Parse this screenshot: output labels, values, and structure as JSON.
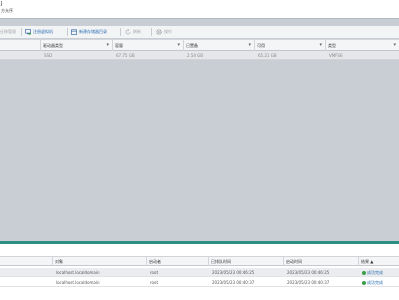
{
  "header": {
    "title": "J",
    "subtitle": "方允序"
  },
  "toolbar": {
    "items": [
      {
        "label": "迁移管理",
        "icon": "partial-icon",
        "state": "disabled"
      },
      {
        "label": "注册虚拟机",
        "icon": "register-vm-icon",
        "state": "enabled"
      },
      {
        "label": "新建存储器目录",
        "icon": "new-folder-icon",
        "state": "enabled"
      },
      {
        "label": "刷新",
        "icon": "refresh-icon",
        "state": "disabled"
      },
      {
        "label": "操作",
        "icon": "gear-icon",
        "state": "disabled"
      }
    ]
  },
  "datastores": {
    "columns": [
      "",
      "驱动器类型",
      "容量",
      "已置备",
      "可用",
      "类型"
    ],
    "rows": [
      {
        "name": "",
        "drive_type": "SSD",
        "capacity": "67.75 GB",
        "provisioned": "2.54 GB",
        "free": "65.21 GB",
        "type": "VMFS6"
      }
    ]
  },
  "tasks": {
    "columns": [
      "",
      "对象",
      "启动者",
      "已排队时间",
      "启动时间",
      "结果 ▲"
    ],
    "rows": [
      {
        "name": "",
        "object": "localhost.localdomain",
        "initiator": "root",
        "queued": "2023/05/23 00:46:25",
        "started": "2023/05/23 00:46:25",
        "result": "成功完成"
      },
      {
        "name": "",
        "object": "localhost.localdomain",
        "initiator": "root",
        "queued": "2023/05/23 00:40:37",
        "started": "2023/05/23 00:40:37",
        "result": "成功完成"
      }
    ]
  },
  "colors": {
    "accent": "#2f8e84",
    "link": "#2a6cb0",
    "success": "#3aa04a"
  }
}
